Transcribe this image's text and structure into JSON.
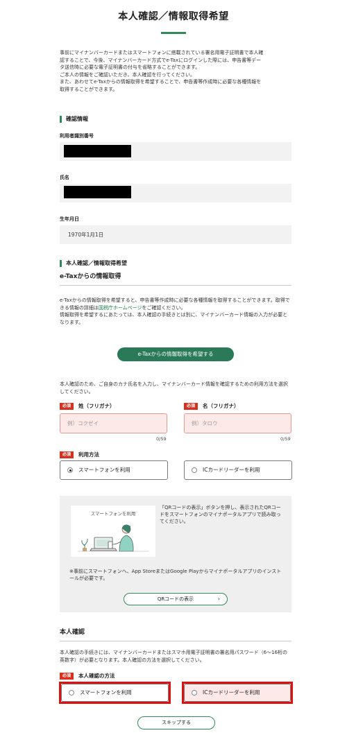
{
  "page_title": "本人確認／情報取得希望",
  "intro_lines": [
    "事前にマイナンバーカードまたはスマートフォンに搭載されている署名用電子証明書で本人確",
    "認することで、今後、マイナンバーカード方式でe-Taxにログインした際には、申告書等デー",
    "タ送信時に必要な電子証明書の付与を省略することができます。",
    "ご本人の情報をご確認いただき、本人確認を行ってください。",
    "また、あわせてe-Taxからの情報取得を希望することで、申告書等作成時に必要な各種情報を",
    "取得することができます。"
  ],
  "confirm_section": {
    "heading": "確認情報",
    "user_id_label": "利用者識別番号",
    "name_label": "氏名",
    "birth_label": "生年月日",
    "birth_value": "1970年1月1日"
  },
  "acquire_section": {
    "heading": "本人確認／情報取得希望",
    "sub_heading": "e-Taxからの情報取得",
    "desc_part1": "e-Taxからの情報取得を希望すると、申告書等作成時に必要な各種情報を取得することができます。取得できる情報の詳細は",
    "desc_link": "国税庁ホームページ",
    "desc_part2": "をご確認ください。",
    "desc_line2": "情報取得を希望するにあたっては、本人確認の手続きとは別に、マイナンバーカード情報の入力が必要となります。",
    "request_button": "e-Taxからの情報取得を希望する",
    "kana_desc": "本人確認のため、ご自身のカナ氏名を入力し、マイナンバーカード情報を確認するための利用方法を選択してください。"
  },
  "form": {
    "required_badge": "必須",
    "last_name_label": "姓（フリガナ）",
    "last_name_placeholder": "例）コクゼイ",
    "last_name_counter": "0/59",
    "first_name_label": "名（フリガナ）",
    "first_name_placeholder": "例）タロウ",
    "first_name_counter": "0/59",
    "usage_label": "利用方法",
    "option_smartphone": "スマートフォンを利用",
    "option_ic_reader": "ICカードリーダーを利用"
  },
  "panel": {
    "illustration_title": "スマートフォンを利用",
    "qr_instruction": "「QRコードの表示」ボタンを押し、表示されたQRコードをスマートフォンのマイナポータルアプリで読み取ってください。",
    "note": "※事前にスマートフォンへ、App StoreまたはGoogle Playからマイナポータルアプリのインストールが必要です。",
    "qr_button": "QRコードの表示",
    "chevron": "›"
  },
  "identity_section": {
    "heading": "本人確認",
    "desc": "本人確認の手続きには、マイナンバーカードまたはスマホ用電子証明書の署名用パスワード（6～16桁の英数字）が必要となります。本人確認の方法を選択してください。",
    "method_label": "本人確認の方法",
    "option_smartphone": "スマートフォンを利用",
    "option_ic_reader": "ICカードリーダーを利用",
    "skip_button": "スキップする"
  },
  "colors": {
    "accent_green": "#2e8b57",
    "button_green": "#2a7a5a",
    "required_red": "#d8301f",
    "highlight_red": "#dd1111",
    "input_pink": "#fde9e7"
  }
}
